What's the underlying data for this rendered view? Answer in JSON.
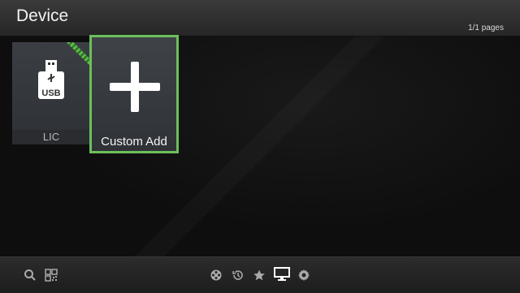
{
  "header": {
    "title": "Device",
    "pages": "1/1 pages"
  },
  "tiles": [
    {
      "label": "LIC",
      "icon": "usb-drive-icon",
      "badge_text": "USB"
    },
    {
      "label": "Custom Add",
      "icon": "plus-icon",
      "selected": true
    }
  ],
  "footer": {
    "icons": [
      "search-icon",
      "qr-code-icon",
      "film-reel-icon",
      "history-icon",
      "star-icon",
      "monitor-icon",
      "gear-icon"
    ],
    "active": "monitor-icon"
  },
  "colors": {
    "selection_border": "#6cbf5a",
    "ribbon": "#5bb94a"
  }
}
